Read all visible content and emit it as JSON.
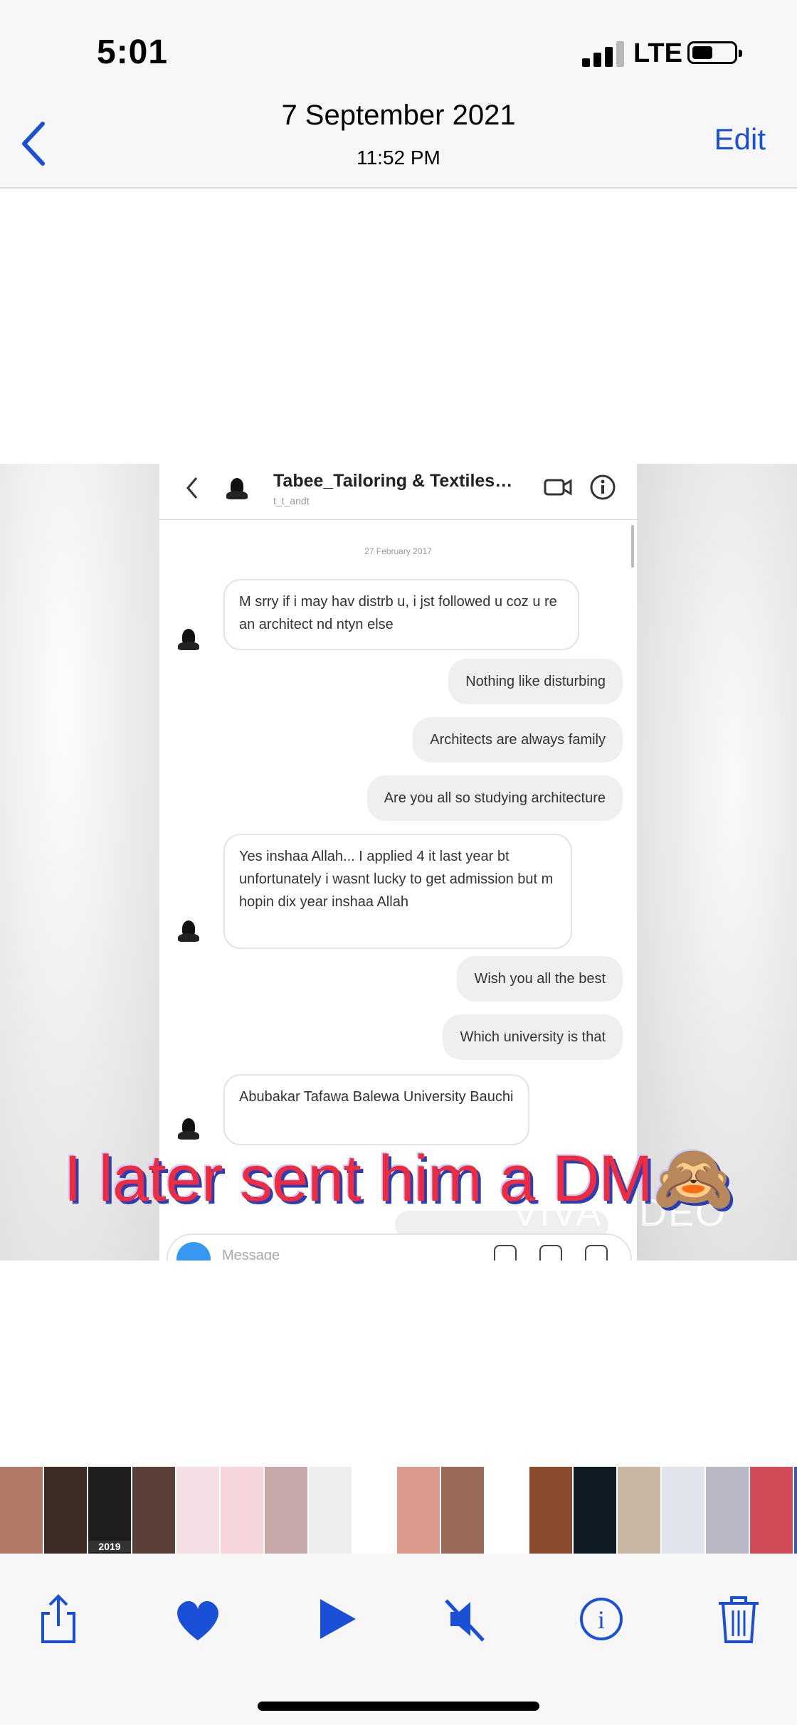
{
  "status_bar": {
    "time": "5:01",
    "network": "LTE",
    "battery_icon": "battery-icon",
    "signal_icon": "signal-bars-icon"
  },
  "header": {
    "date": "7 September 2021",
    "time": "11:52 PM",
    "edit_label": "Edit",
    "back_icon": "chevron-left-icon"
  },
  "photo": {
    "chat": {
      "contact_name": "Tabee_Tailoring & Textiles…",
      "contact_handle": "t_t_andt",
      "date_stamp": "27 February 2017",
      "messages": [
        {
          "from": "them",
          "text": "M srry if i may hav distrb u, i jst followed u coz u re an architect nd ntyn else"
        },
        {
          "from": "me",
          "text": "Nothing like disturbing"
        },
        {
          "from": "me",
          "text": "Architects are always family"
        },
        {
          "from": "me",
          "text": "Are you all so studying architecture"
        },
        {
          "from": "them",
          "text": "Yes inshaa Allah... I applied 4 it last year bt unfortunately i wasnt lucky to get admission but m hopin dix year inshaa Allah"
        },
        {
          "from": "me",
          "text": "Wish you all the best"
        },
        {
          "from": "me",
          "text": "Which university is that"
        },
        {
          "from": "them",
          "text": "Abubakar Tafawa Balewa University Bauchi"
        }
      ],
      "composer_placeholder": "Message"
    },
    "caption": "I later sent him a DM🙈",
    "watermark": "VIVAVIDEO"
  },
  "thumbnails": [
    {
      "color": "#b07a66"
    },
    {
      "color": "#3d2b25"
    },
    {
      "color": "#1e1e1e",
      "label": "2019"
    },
    {
      "color": "#5a4038"
    },
    {
      "color": "#f3dfe4"
    },
    {
      "color": "#f7d5dd"
    },
    {
      "color": "#c6a8a8"
    },
    {
      "color": "#eeeeee"
    },
    {
      "color": "#ffffff"
    },
    {
      "color": "#d99a8c"
    },
    {
      "color": "#9a6b58"
    },
    {
      "color": "#ffffff"
    },
    {
      "color": "#8a4a2c"
    },
    {
      "color": "#0e1a24"
    },
    {
      "color": "#c9b7a6"
    },
    {
      "color": "#e0e4ea"
    },
    {
      "color": "#b8b8c4"
    },
    {
      "color": "#d14c58"
    },
    {
      "color": "#4055b0"
    },
    {
      "color": "#c23b4a"
    }
  ],
  "toolbar": {
    "share_icon": "share-icon",
    "favorite_icon": "heart-icon",
    "play_icon": "play-icon",
    "mute_icon": "speaker-muted-icon",
    "info_icon": "info-icon",
    "delete_icon": "trash-icon",
    "accent_color": "#1a4fd8"
  }
}
